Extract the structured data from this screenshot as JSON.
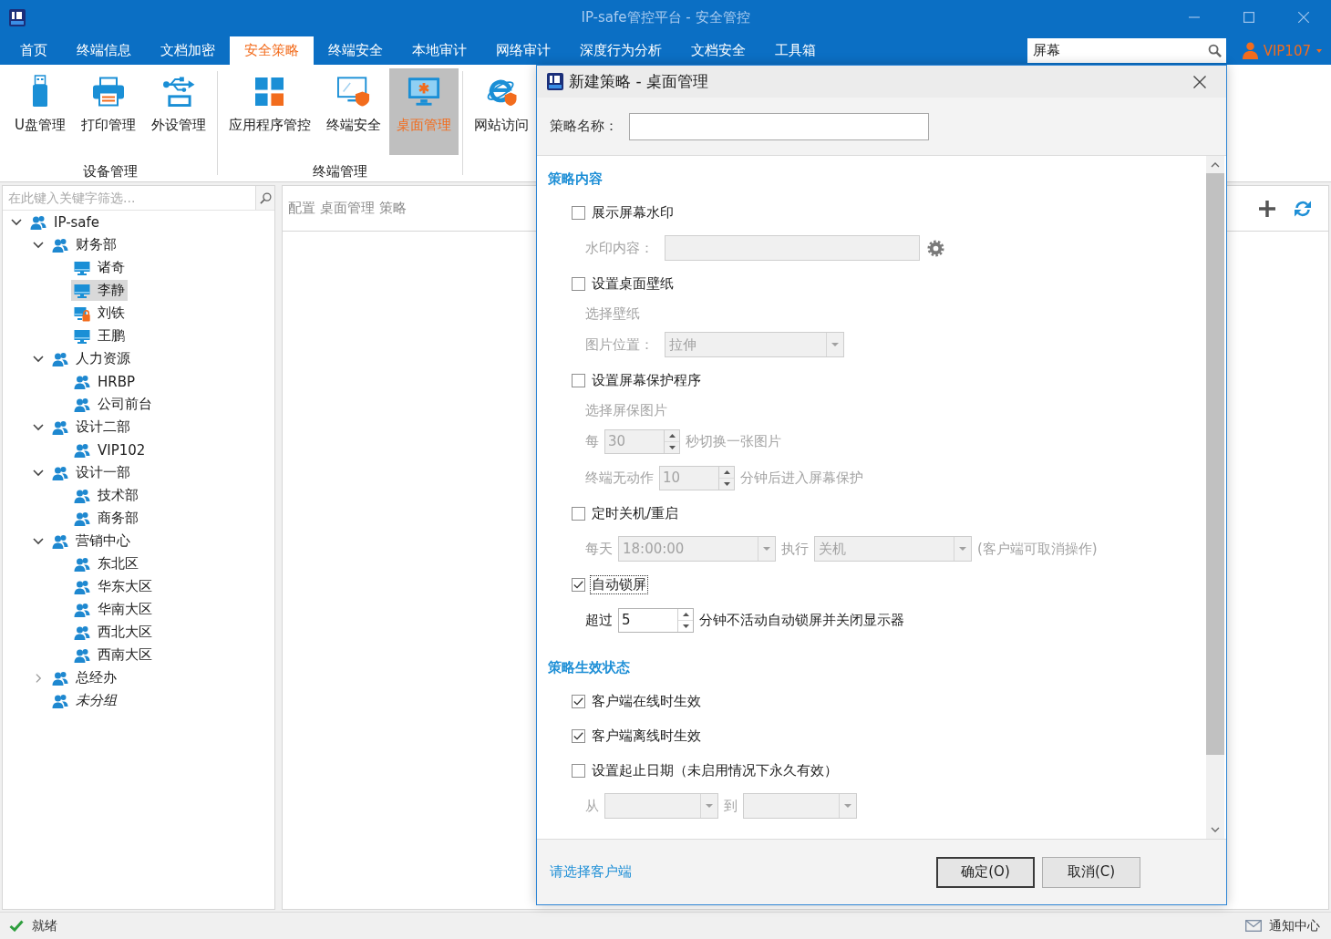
{
  "window": {
    "title": "IP-safe管控平台 - 安全管控"
  },
  "tabs": [
    {
      "label": "首页",
      "selected": false
    },
    {
      "label": "终端信息",
      "selected": false
    },
    {
      "label": "文档加密",
      "selected": false
    },
    {
      "label": "安全策略",
      "selected": true
    },
    {
      "label": "终端安全",
      "selected": false
    },
    {
      "label": "本地审计",
      "selected": false
    },
    {
      "label": "网络审计",
      "selected": false
    },
    {
      "label": "深度行为分析",
      "selected": false
    },
    {
      "label": "文档安全",
      "selected": false
    },
    {
      "label": "工具箱",
      "selected": false
    }
  ],
  "search": {
    "value": "屏幕"
  },
  "user": {
    "name": "VIP107"
  },
  "ribbon": {
    "groups": [
      {
        "label": "设备管理",
        "items": [
          {
            "label": "U盘管理",
            "selected": false
          },
          {
            "label": "打印管理",
            "selected": false
          },
          {
            "label": "外设管理",
            "selected": false
          }
        ]
      },
      {
        "label": "终端管理",
        "items": [
          {
            "label": "应用程序管控",
            "selected": false
          },
          {
            "label": "终端安全",
            "selected": false
          },
          {
            "label": "桌面管理",
            "selected": true
          }
        ]
      },
      {
        "items": [
          {
            "label": "网站访问",
            "selected": false
          }
        ]
      }
    ]
  },
  "tree": {
    "filter": {
      "placeholder": "在此键入关键字筛选..."
    },
    "items": [
      {
        "label": "IP-safe",
        "kind": "group",
        "selected": false,
        "expanded": true,
        "children": [
          {
            "label": "财务部",
            "kind": "group",
            "selected": false,
            "expanded": true,
            "children": [
              {
                "label": "诸奇",
                "kind": "computer",
                "selected": false
              },
              {
                "label": "李静",
                "kind": "computer",
                "selected": true
              },
              {
                "label": "刘铁",
                "kind": "computer-locked",
                "selected": false
              },
              {
                "label": "王鹏",
                "kind": "computer",
                "selected": false
              }
            ]
          },
          {
            "label": "人力资源",
            "kind": "group",
            "selected": false,
            "expanded": true,
            "children": [
              {
                "label": "HRBP",
                "kind": "group",
                "selected": false
              },
              {
                "label": "公司前台",
                "kind": "group",
                "selected": false
              }
            ]
          },
          {
            "label": "设计二部",
            "kind": "group",
            "selected": false,
            "expanded": true,
            "children": [
              {
                "label": "VIP102",
                "kind": "group",
                "selected": false
              }
            ]
          },
          {
            "label": "设计一部",
            "kind": "group",
            "selected": false,
            "expanded": true,
            "children": [
              {
                "label": "技术部",
                "kind": "group",
                "selected": false
              },
              {
                "label": "商务部",
                "kind": "group",
                "selected": false
              }
            ]
          },
          {
            "label": "营销中心",
            "kind": "group",
            "selected": false,
            "expanded": true,
            "children": [
              {
                "label": "东北区",
                "kind": "group",
                "selected": false
              },
              {
                "label": "华东大区",
                "kind": "group",
                "selected": false
              },
              {
                "label": "华南大区",
                "kind": "group",
                "selected": false
              },
              {
                "label": "西北大区",
                "kind": "group",
                "selected": false
              },
              {
                "label": "西南大区",
                "kind": "group",
                "selected": false
              }
            ]
          },
          {
            "label": "总经办",
            "kind": "group",
            "selected": false,
            "expanded": false
          },
          {
            "label": "未分组",
            "kind": "ungrouped",
            "selected": false
          }
        ]
      }
    ]
  },
  "content": {
    "breadcrumb": "配置 桌面管理 策略"
  },
  "dialog": {
    "title": "新建策略 - 桌面管理",
    "name_label": "策略名称：",
    "sections": [
      {
        "title": "策略内容",
        "items": [
          {
            "kind": "checkbox",
            "label": "展示屏幕水印",
            "checked": false,
            "focused": false
          },
          {
            "kind": "row",
            "disabled": true,
            "parts": [
              {
                "kind": "label",
                "text": "水印内容："
              },
              {
                "kind": "field",
                "settings": true
              }
            ]
          },
          {
            "kind": "checkbox",
            "label": "设置桌面壁纸",
            "checked": false,
            "focused": false
          },
          {
            "kind": "link",
            "label": "选择壁纸",
            "disabled": true
          },
          {
            "kind": "row",
            "disabled": true,
            "parts": [
              {
                "kind": "label",
                "text": "图片位置："
              },
              {
                "kind": "dropdown",
                "value": "拉伸"
              }
            ]
          },
          {
            "kind": "checkbox",
            "label": "设置屏幕保护程序",
            "checked": false,
            "focused": false
          },
          {
            "kind": "link",
            "label": "选择屏保图片",
            "disabled": true
          },
          {
            "kind": "row",
            "disabled": true,
            "parts": [
              {
                "kind": "label",
                "text": "每"
              },
              {
                "kind": "spinner",
                "value": "30"
              },
              {
                "kind": "label",
                "text": "秒切换一张图片"
              }
            ]
          },
          {
            "kind": "row",
            "disabled": true,
            "parts": [
              {
                "kind": "label",
                "text": "终端无动作"
              },
              {
                "kind": "spinner",
                "value": "10"
              },
              {
                "kind": "label",
                "text": "分钟后进入屏幕保护"
              }
            ]
          },
          {
            "kind": "checkbox",
            "label": "定时关机/重启",
            "checked": false,
            "focused": false
          },
          {
            "kind": "row",
            "disabled": true,
            "parts": [
              {
                "kind": "label",
                "text": "每天"
              },
              {
                "kind": "dropdown",
                "value": "18:00:00"
              },
              {
                "kind": "label",
                "text": "执行"
              },
              {
                "kind": "dropdown",
                "value": "关机"
              },
              {
                "kind": "label",
                "text": "(客户端可取消操作)"
              }
            ]
          },
          {
            "kind": "checkbox",
            "label": "自动锁屏",
            "checked": true,
            "focused": true
          },
          {
            "kind": "row",
            "disabled": false,
            "parts": [
              {
                "kind": "label",
                "text": "超过"
              },
              {
                "kind": "spinner",
                "value": "5"
              },
              {
                "kind": "label",
                "text": "分钟不活动自动锁屏并关闭显示器"
              }
            ]
          }
        ]
      },
      {
        "title": "策略生效状态",
        "items": [
          {
            "kind": "checkbox",
            "label": "客户端在线时生效",
            "checked": true,
            "focused": false
          },
          {
            "kind": "checkbox",
            "label": "客户端离线时生效",
            "checked": true,
            "focused": false
          },
          {
            "kind": "checkbox",
            "label": "设置起止日期（未启用情况下永久有效）",
            "checked": false,
            "focused": false
          },
          {
            "kind": "row",
            "disabled": true,
            "parts": [
              {
                "kind": "label",
                "text": "从"
              },
              {
                "kind": "dropdown"
              },
              {
                "kind": "label",
                "text": "到"
              },
              {
                "kind": "dropdown"
              }
            ]
          }
        ]
      }
    ],
    "footer": {
      "link": "请选择客户端",
      "buttons": [
        {
          "label": "确定(O)",
          "default": true
        },
        {
          "label": "取消(C)",
          "default": false
        }
      ]
    }
  },
  "status_bar": {
    "text": "就绪",
    "notifications": "通知中心"
  }
}
